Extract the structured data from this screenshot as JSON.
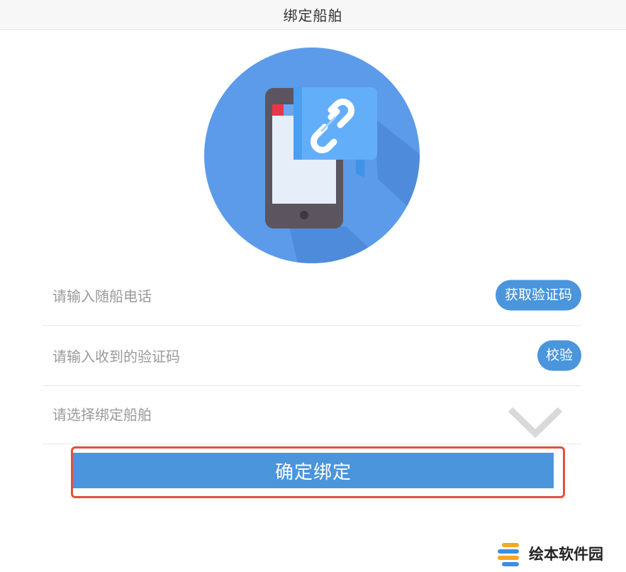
{
  "header": {
    "title": "绑定船舶"
  },
  "hero": {
    "icon": "phone-link-icon"
  },
  "form": {
    "phone_placeholder": "请输入随船电话",
    "get_code_label": "获取验证码",
    "code_placeholder": "请输入收到的验证码",
    "verify_label": "校验",
    "ship_placeholder": "请选择绑定船舶"
  },
  "actions": {
    "confirm_label": "确定绑定"
  },
  "watermark": {
    "text": "绘本软件园"
  },
  "colors": {
    "accent": "#4a95db",
    "circle": "#5b9bea",
    "highlight_border": "#e2503f"
  }
}
